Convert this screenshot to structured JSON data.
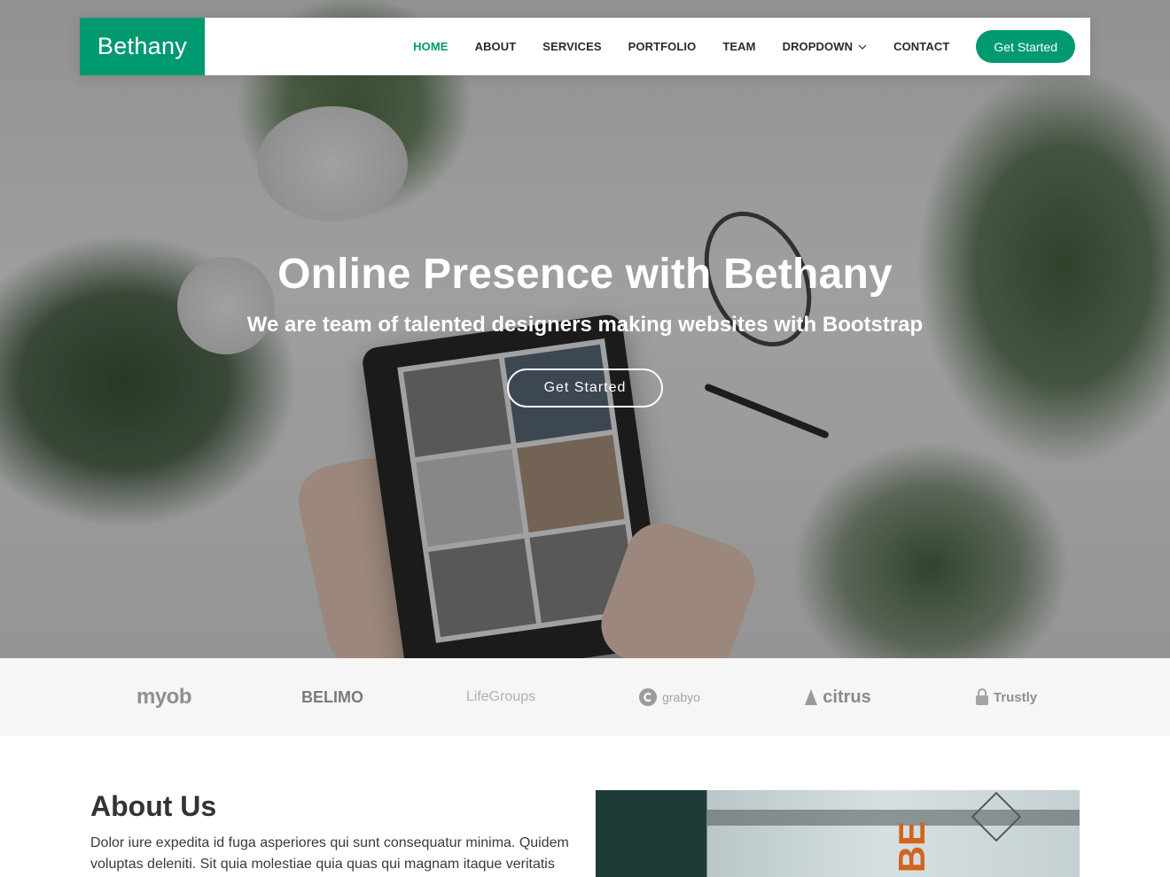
{
  "colors": {
    "brand": "#009970",
    "white": "#ffffff",
    "text": "#333333"
  },
  "header": {
    "logo": "Bethany",
    "nav": [
      {
        "label": "HOME",
        "active": true
      },
      {
        "label": "ABOUT"
      },
      {
        "label": "SERVICES"
      },
      {
        "label": "PORTFOLIO"
      },
      {
        "label": "TEAM"
      },
      {
        "label": "DROPDOWN",
        "icon": "chevron-down-icon"
      },
      {
        "label": "CONTACT"
      }
    ],
    "cta": "Get Started"
  },
  "hero": {
    "title": "Online Presence with Bethany",
    "subtitle": "We are team of talented designers making websites with Bootstrap",
    "button": "Get Started"
  },
  "clients": [
    {
      "name": "myob"
    },
    {
      "name": "BELIMO"
    },
    {
      "name": "LifeGroups"
    },
    {
      "name": "grabyo",
      "icon": "grabyo-icon"
    },
    {
      "name": "citrus",
      "icon": "citrus-icon"
    },
    {
      "name": "Trustly",
      "icon": "lock-icon"
    }
  ],
  "about": {
    "title": "About Us",
    "text": "Dolor iure expedita id fuga asperiores qui sunt consequatur minima. Quidem voluptas deleniti. Sit quia molestiae quia quas qui magnam itaque veritatis"
  }
}
